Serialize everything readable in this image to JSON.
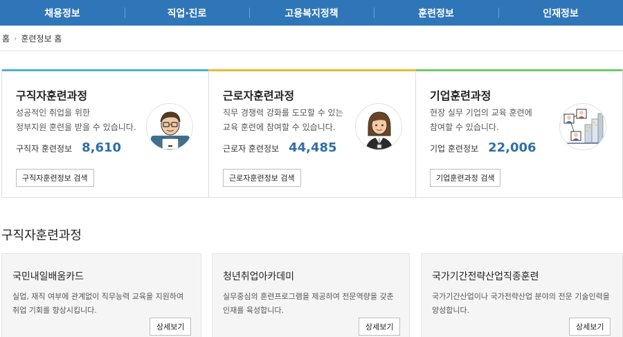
{
  "nav": {
    "items": [
      "채용정보",
      "직업·진로",
      "고용복지정책",
      "훈련정보",
      "인재정보"
    ]
  },
  "breadcrumb": {
    "home": "홈",
    "current": "훈련정보 홈"
  },
  "summary": {
    "cards": [
      {
        "title": "구직자훈련과정",
        "desc_line1": "성공적인 취업을 위한",
        "desc_line2": "정부지원 훈련을 받을 수 있습니다.",
        "count_label": "구직자 훈련정보",
        "count": "8,610",
        "button": "구직자훈련정보 검색",
        "accent": "#4bb0d4",
        "avatar_icon": "job-seeker-man-icon"
      },
      {
        "title": "근로자훈련과정",
        "desc_line1": "직무 경쟁력 강화를 도모할 수 있는",
        "desc_line2": "교육 훈련에 참여할 수 있습니다.",
        "count_label": "근로자 훈련정보",
        "count": "44,485",
        "button": "근로자훈련정보 검색",
        "accent": "#f3b532",
        "avatar_icon": "worker-woman-icon"
      },
      {
        "title": "기업훈련과정",
        "desc_line1": "현장 실무 기업의 교육 훈련에",
        "desc_line2": "참여할 수 있습니다.",
        "count_label": "기업 훈련정보",
        "count": "22,006",
        "button": "기업훈련과정 검색",
        "accent": "#6ec965",
        "avatar_icon": "company-building-icon"
      }
    ]
  },
  "section": {
    "title": "구직자훈련과정"
  },
  "courses": [
    {
      "title": "국민내일배움카드",
      "desc_line1": "실업, 재직 여부에 관계없이 직무능력 교육을 지원하여",
      "desc_line2": "취업 기회를 향상시킵니다.",
      "button": "상세보기"
    },
    {
      "title": "청년취업아카데미",
      "desc_line1": "실무중심의 훈련프로그램을 제공하여 전문역량을 갖춘",
      "desc_line2": "인재를 육성합니다.",
      "button": "상세보기"
    },
    {
      "title": "국가기간전략산업직종훈련",
      "desc_line1": "국가기간산업이나 국가전략산업 분야의 전문 기술인력을",
      "desc_line2": "양성합니다.",
      "button": "상세보기"
    }
  ],
  "colors": {
    "nav_bg": "#2f76b9",
    "count_blue": "#2f6ea8"
  }
}
